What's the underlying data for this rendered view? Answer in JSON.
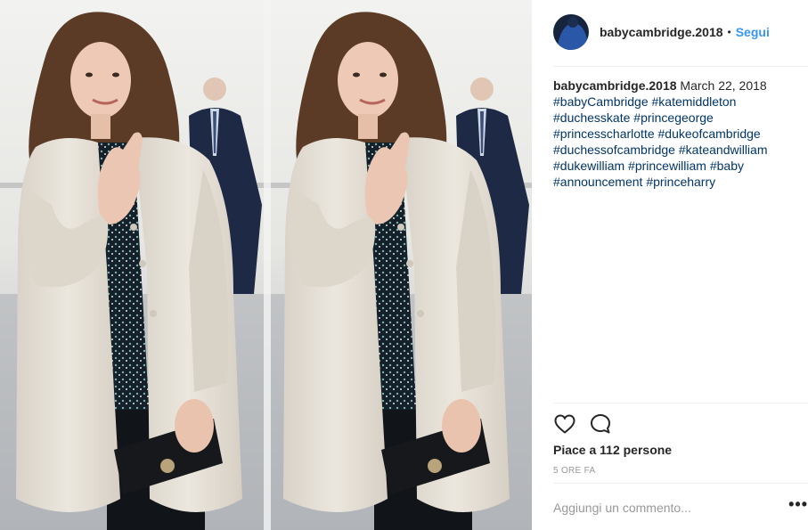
{
  "post": {
    "image_description_icon": "photo",
    "header": {
      "username": "babycambridge.2018",
      "separator": "•",
      "follow_label": "Segui"
    },
    "caption": {
      "username": "babycambridge.2018",
      "date": "March 22, 2018",
      "hashtags": [
        "#babyCambridge",
        "#katemiddleton",
        "#duchesskate",
        "#princegeorge",
        "#princesscharlotte",
        "#dukeofcambridge",
        "#duchessofcambridge",
        "#kateandwilliam",
        "#dukewilliam",
        "#princewilliam",
        "#baby",
        "#announcement",
        "#princeharry"
      ]
    },
    "actions": {
      "like_icon": "heart-icon",
      "comment_icon": "comment-icon"
    },
    "likes_text": "Piace a 112 persone",
    "timestamp": "5 ORE FA",
    "comment": {
      "placeholder": "Aggiungi un commento...",
      "more_label": "•••"
    },
    "colors": {
      "follow_blue": "#3897f0",
      "hashtag": "#003569",
      "muted": "#999999",
      "text": "#262626"
    }
  }
}
